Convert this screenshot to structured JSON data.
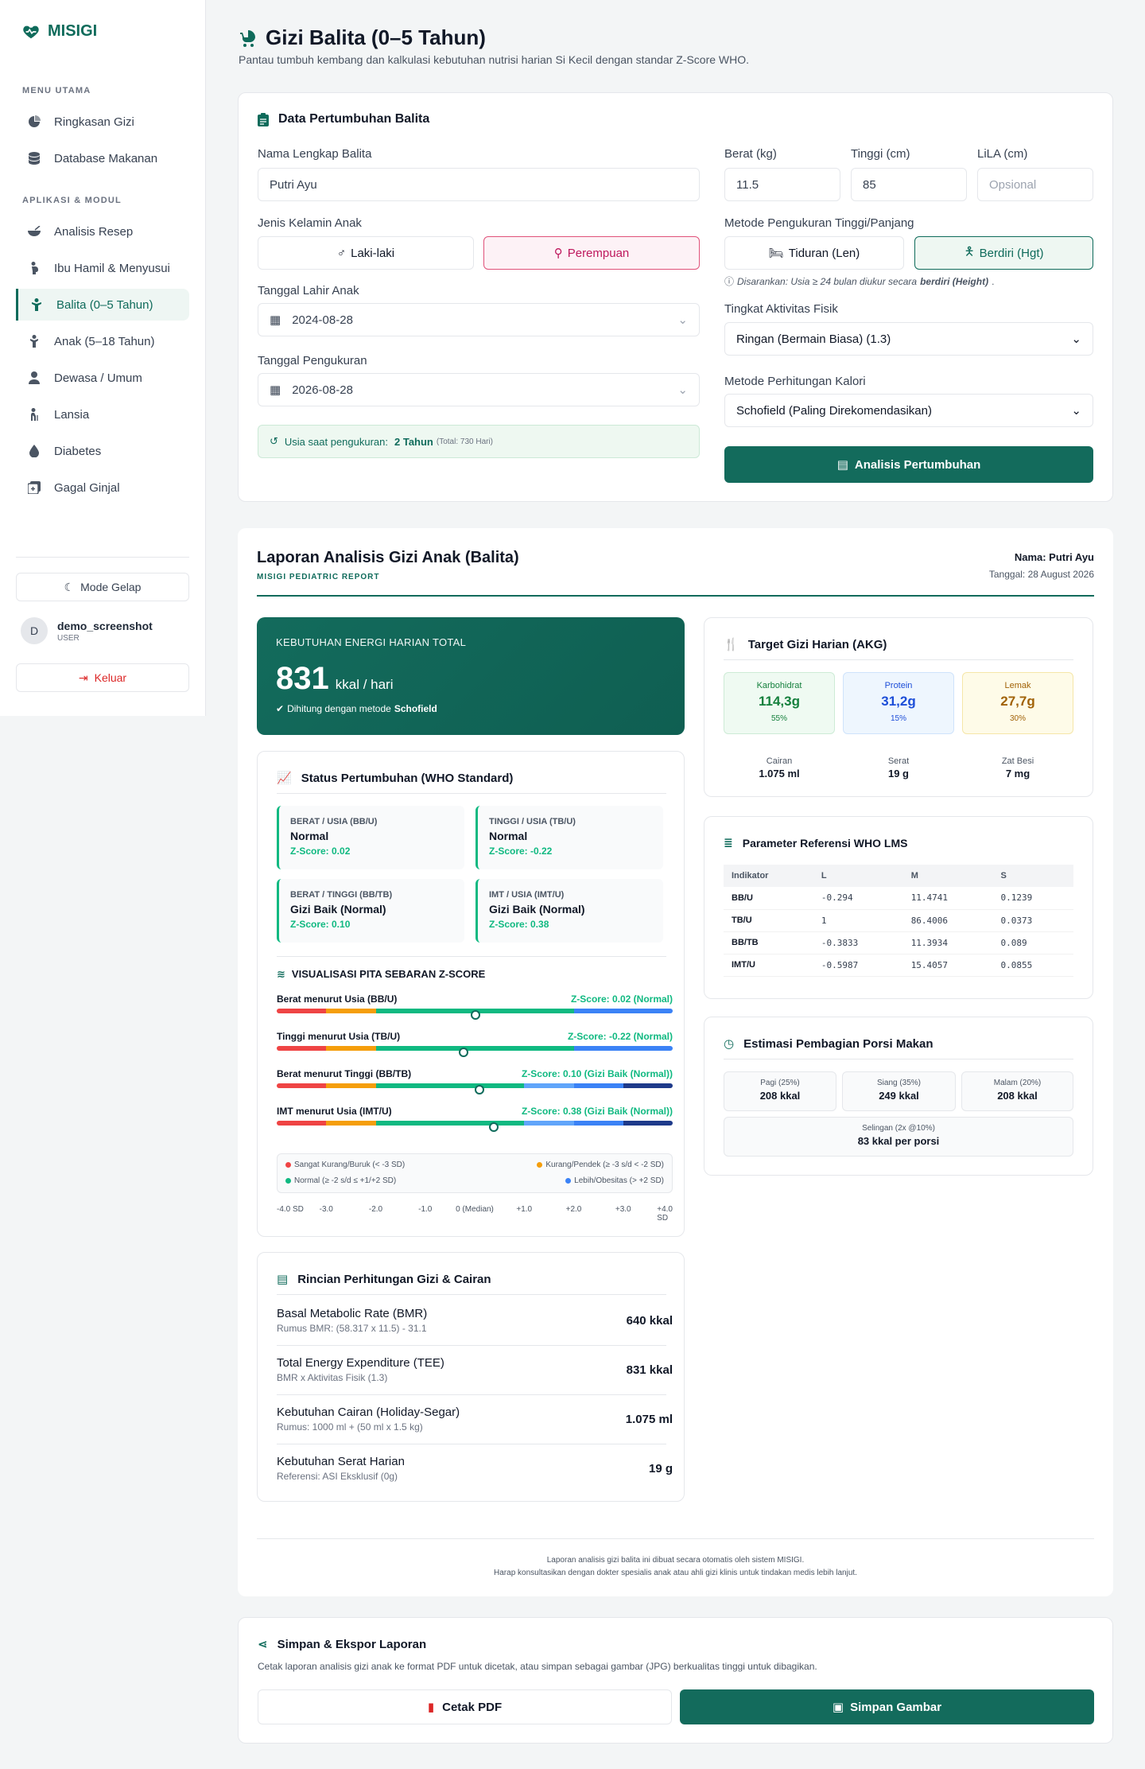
{
  "app": {
    "name": "MISIGI"
  },
  "sidebar": {
    "section_main": "MENU UTAMA",
    "section_apps": "APLIKASI & MODUL",
    "main_items": [
      {
        "label": "Ringkasan Gizi",
        "icon": "pie-chart-icon"
      },
      {
        "label": "Database Makanan",
        "icon": "database-icon"
      }
    ],
    "app_items": [
      {
        "label": "Analisis Resep",
        "icon": "bowl-icon"
      },
      {
        "label": "Ibu Hamil & Menyusui",
        "icon": "pregnant-icon"
      },
      {
        "label": "Balita (0–5 Tahun)",
        "icon": "child-icon"
      },
      {
        "label": "Anak (5–18 Tahun)",
        "icon": "kid-icon"
      },
      {
        "label": "Dewasa / Umum",
        "icon": "user-icon"
      },
      {
        "label": "Lansia",
        "icon": "elderly-icon"
      },
      {
        "label": "Diabetes",
        "icon": "drop-icon"
      },
      {
        "label": "Gagal Ginjal",
        "icon": "kidney-icon"
      }
    ],
    "dark_mode": "Mode Gelap",
    "user_name": "demo_screenshot",
    "user_role": "USER",
    "avatar_letter": "D",
    "logout": "Keluar"
  },
  "header": {
    "title": "Gizi Balita (0–5 Tahun)",
    "subtitle": "Pantau tumbuh kembang dan kalkulasi kebutuhan nutrisi harian Si Kecil dengan standar Z-Score WHO."
  },
  "form": {
    "title": "Data Pertumbuhan Balita",
    "name_label": "Nama Lengkap Balita",
    "name_value": "Putri Ayu",
    "gender_label": "Jenis Kelamin Anak",
    "gender_male": "Laki-laki",
    "gender_female": "Perempuan",
    "dob_label": "Tanggal Lahir Anak",
    "dob_value": "2024-08-28",
    "measure_date_label": "Tanggal Pengukuran",
    "measure_date_value": "2026-08-28",
    "age_prefix": "Usia saat pengukuran:",
    "age_value": "2 Tahun",
    "age_total": "(Total: 730 Hari)",
    "weight_label": "Berat (kg)",
    "weight_value": "11.5",
    "height_label": "Tinggi (cm)",
    "height_value": "85",
    "lila_label": "LiLA (cm)",
    "lila_placeholder": "Opsional",
    "method_label": "Metode Pengukuran Tinggi/Panjang",
    "method_len": "Tiduran (Len)",
    "method_hgt": "Berdiri (Hgt)",
    "method_note_prefix": "Disarankan: Usia ≥ 24 bulan diukur secara",
    "method_note_bold": "berdiri (Height)",
    "activity_label": "Tingkat Aktivitas Fisik",
    "activity_value": "Ringan (Bermain Biasa) (1.3)",
    "calc_label": "Metode Perhitungan Kalori",
    "calc_value": "Schofield (Paling Direkomendasikan)",
    "analyze_button": "Analisis Pertumbuhan"
  },
  "report": {
    "title": "Laporan Analisis Gizi Anak (Balita)",
    "subtitle": "MISIGI PEDIATRIC REPORT",
    "name_line": "Nama: Putri Ayu",
    "date_line": "Tanggal: 28 August 2026",
    "energy_label": "KEBUTUHAN ENERGI HARIAN TOTAL",
    "energy_value": "831",
    "energy_unit": "kkal / hari",
    "energy_method_prefix": "Dihitung dengan metode",
    "energy_method": "Schofield",
    "status_title": "Status Pertumbuhan (WHO Standard)",
    "status": [
      {
        "title": "BERAT / USIA (BB/U)",
        "value": "Normal",
        "z": "Z-Score: 0.02"
      },
      {
        "title": "TINGGI / USIA (TB/U)",
        "value": "Normal",
        "z": "Z-Score: -0.22"
      },
      {
        "title": "BERAT / TINGGI (BB/TB)",
        "value": "Gizi Baik (Normal)",
        "z": "Z-Score: 0.10"
      },
      {
        "title": "IMT / USIA (IMT/U)",
        "value": "Gizi Baik (Normal)",
        "z": "Z-Score: 0.38"
      }
    ],
    "viz_title": "VISUALISASI PITA SEBARAN Z-SCORE",
    "bars": [
      {
        "label": "Berat menurut Usia (BB/U)",
        "result": "Z-Score: 0.02 (Normal)",
        "z": 0.02
      },
      {
        "label": "Tinggi menurut Usia (TB/U)",
        "result": "Z-Score: -0.22 (Normal)",
        "z": -0.22
      },
      {
        "label": "Berat menurut Tinggi (BB/TB)",
        "result": "Z-Score: 0.10 (Gizi Baik (Normal))",
        "z": 0.1
      },
      {
        "label": "IMT menurut Usia (IMT/U)",
        "result": "Z-Score: 0.38 (Gizi Baik (Normal))",
        "z": 0.38
      }
    ],
    "legend": {
      "severe": "Sangat Kurang/Buruk (< -3 SD)",
      "low": "Kurang/Pendek (≥ -3 s/d < -2 SD)",
      "normal": "Normal (≥ -2 s/d ≤ +1/+2 SD)",
      "high": "Lebih/Obesitas (> +2 SD)"
    },
    "axis_ticks": [
      "-4.0 SD",
      "-3.0",
      "-2.0",
      "-1.0",
      "0 (Median)",
      "+1.0",
      "+2.0",
      "+3.0",
      "+4.0 SD"
    ],
    "calc_title": "Rincian Perhitungan Gizi & Cairan",
    "calc": [
      {
        "name": "Basal Metabolic Rate (BMR)",
        "sub": "Rumus BMR: (58.317 x 11.5) - 31.1",
        "value": "640 kkal"
      },
      {
        "name": "Total Energy Expenditure (TEE)",
        "sub": "BMR x Aktivitas Fisik (1.3)",
        "value": "831 kkal"
      },
      {
        "name": "Kebutuhan Cairan (Holiday-Segar)",
        "sub": "Rumus: 1000 ml + (50 ml x 1.5 kg)",
        "value": "1.075 ml"
      },
      {
        "name": "Kebutuhan Serat Harian",
        "sub": "Referensi: ASI Eksklusif (0g)",
        "value": "19 g"
      }
    ],
    "akg_title": "Target Gizi Harian (AKG)",
    "macros": [
      {
        "name": "Karbohidrat",
        "value": "114,3g",
        "pct": "55%"
      },
      {
        "name": "Protein",
        "value": "31,2g",
        "pct": "15%"
      },
      {
        "name": "Lemak",
        "value": "27,7g",
        "pct": "30%"
      }
    ],
    "minis": [
      {
        "name": "Cairan",
        "value": "1.075 ml"
      },
      {
        "name": "Serat",
        "value": "19 g"
      },
      {
        "name": "Zat Besi",
        "value": "7 mg"
      }
    ],
    "lms_title": "Parameter Referensi WHO LMS",
    "lms_headers": [
      "Indikator",
      "L",
      "M",
      "S"
    ],
    "lms_rows": [
      [
        "BB/U",
        "-0.294",
        "11.4741",
        "0.1239"
      ],
      [
        "TB/U",
        "1",
        "86.4006",
        "0.0373"
      ],
      [
        "BB/TB",
        "-0.3833",
        "11.3934",
        "0.089"
      ],
      [
        "IMT/U",
        "-0.5987",
        "15.4057",
        "0.0855"
      ]
    ],
    "portion_title": "Estimasi Pembagian Porsi Makan",
    "portions": [
      {
        "name": "Pagi (25%)",
        "value": "208 kkal"
      },
      {
        "name": "Siang (35%)",
        "value": "249 kkal"
      },
      {
        "name": "Malam (20%)",
        "value": "208 kkal"
      }
    ],
    "snack_name": "Selingan (2x @10%)",
    "snack_value": "83 kkal per porsi",
    "footer_1": "Laporan analisis gizi balita ini dibuat secara otomatis oleh sistem MISIGI.",
    "footer_2": "Harap konsultasikan dengan dokter spesialis anak atau ahli gizi klinis untuk tindakan medis lebih lanjut."
  },
  "export": {
    "title": "Simpan & Ekspor Laporan",
    "desc": "Cetak laporan analisis gizi anak ke format PDF untuk dicetak, atau simpan sebagai gambar (JPG) berkualitas tinggi untuk dibagikan.",
    "pdf_button": "Cetak PDF",
    "image_button": "Simpan Gambar"
  },
  "colors": {
    "primary": "#136b5c",
    "severe": "#ef4444",
    "low": "#f59e0b",
    "normal": "#10b981",
    "high": "#3b82f6"
  }
}
